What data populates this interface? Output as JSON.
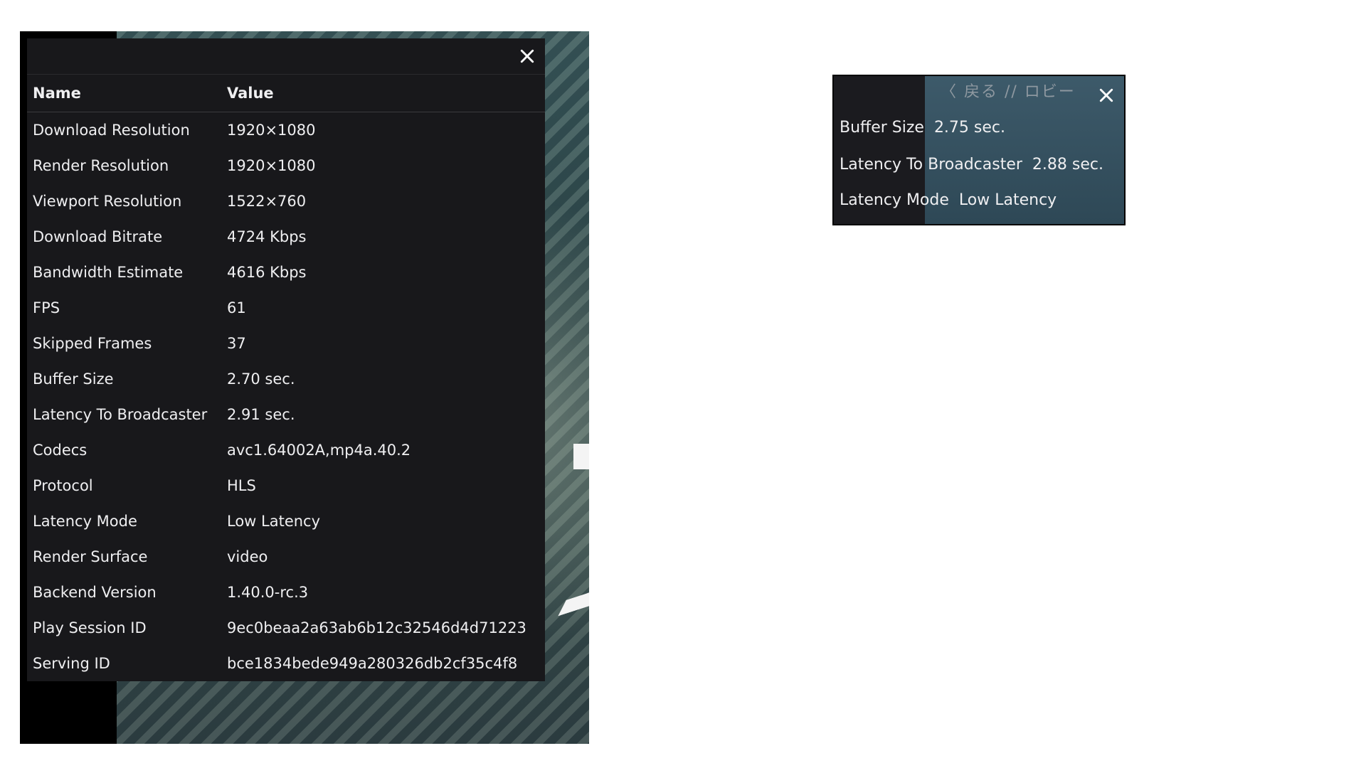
{
  "left_panel": {
    "headers": {
      "name": "Name",
      "value": "Value"
    },
    "rows": [
      {
        "name": "Download Resolution",
        "value": "1920×1080"
      },
      {
        "name": "Render Resolution",
        "value": "1920×1080"
      },
      {
        "name": "Viewport Resolution",
        "value": "1522×760"
      },
      {
        "name": "Download Bitrate",
        "value": "4724 Kbps"
      },
      {
        "name": "Bandwidth Estimate",
        "value": "4616 Kbps"
      },
      {
        "name": "FPS",
        "value": "61"
      },
      {
        "name": "Skipped Frames",
        "value": "37"
      },
      {
        "name": "Buffer Size",
        "value": "2.70 sec."
      },
      {
        "name": "Latency To Broadcaster",
        "value": "2.91 sec."
      },
      {
        "name": "Codecs",
        "value": "avc1.64002A,mp4a.40.2"
      },
      {
        "name": "Protocol",
        "value": "HLS"
      },
      {
        "name": "Latency Mode",
        "value": "Low Latency"
      },
      {
        "name": "Render Surface",
        "value": "video"
      },
      {
        "name": "Backend Version",
        "value": "1.40.0-rc.3"
      },
      {
        "name": "Play Session ID",
        "value": "9ec0beaa2a63ab6b12c32546d4d71223"
      },
      {
        "name": "Serving ID",
        "value": "bce1834bede949a280326db2cf35c4f8"
      }
    ],
    "close_icon": "close-icon"
  },
  "right_panel": {
    "background_nav_text": "〈 戻る // ロビー",
    "rows": [
      {
        "name": "Buffer Size",
        "value": "2.75 sec."
      },
      {
        "name": "Latency To Broadcaster",
        "value": "2.88 sec."
      },
      {
        "name": "Latency Mode",
        "value": "Low Latency"
      }
    ],
    "close_icon": "close-icon"
  },
  "colors": {
    "panel_bg": "#18181b",
    "text": "#efeff1",
    "page_bg": "#ffffff"
  }
}
